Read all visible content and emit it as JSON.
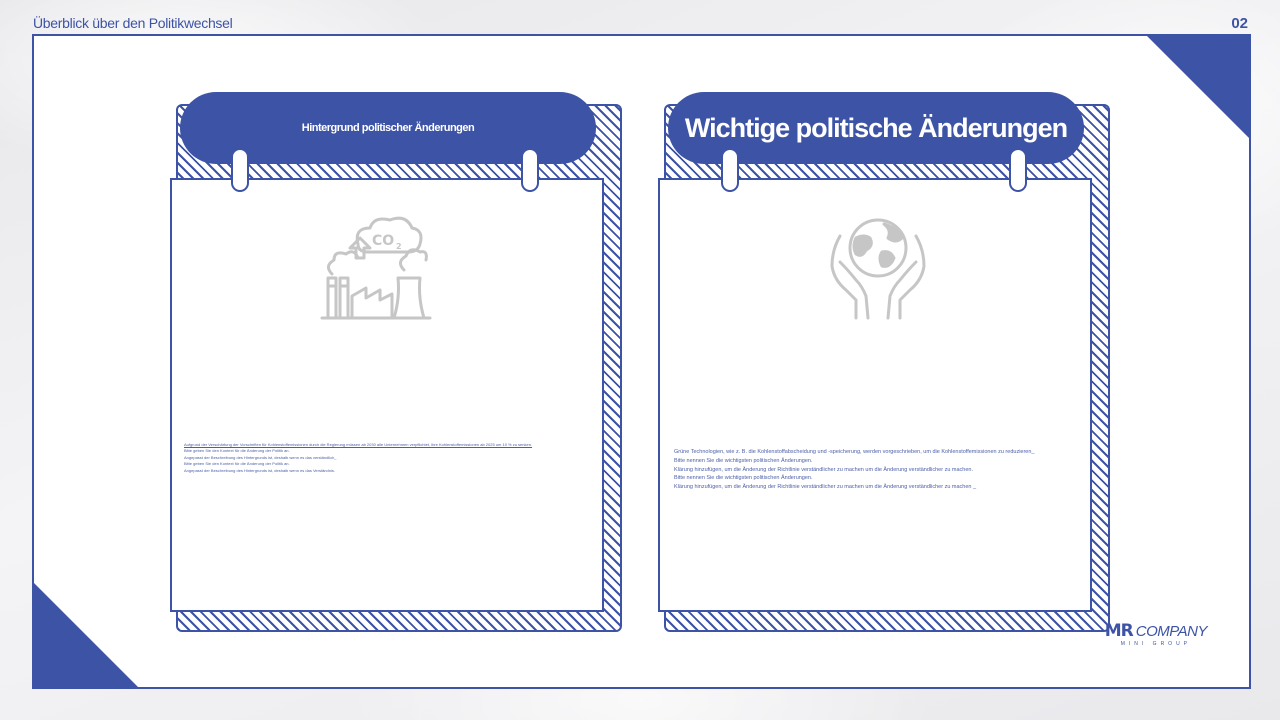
{
  "header": {
    "title": "Überblick über den Politikwechsel",
    "page_number": "02"
  },
  "colors": {
    "accent": "#3d53a5",
    "icon_gray": "#c6c6c6",
    "background": "#efeff1"
  },
  "cards": [
    {
      "heading": "Hintergrund politischer Änderungen",
      "icon": "co2-factory-icon",
      "lines": [
        "Aufgrund der Verschärfung der Vorschriften für Kohlenstoffemissionen durch die Regierung müssen ab 2030 alle Unternehmen verpflichtet, ihre Kohlenstoffemissionen ab 2025 um 10 % zu senken.",
        "Bitte geben Sie den Kontext für die Änderung der Politik an.",
        "Angepasst der Beschreibung des Hintergrunds ist, deshalb wenn es das verständlich_",
        "Bitte geben Sie den Kontext für die Änderung der Politik an.",
        "Angepasst der Beschreibung des Hintergrunds ist, deshalb wenn es das Verständnis."
      ]
    },
    {
      "heading": "Wichtige politische Änderungen",
      "icon": "globe-in-hands-icon",
      "lines": [
        "Grüne Technologien, wie z. B. die Kohlenstoffabscheidung und -speicherung, werden vorgeschrieben, um die Kohlenstoffemissionen zu reduzieren_",
        "Bitte nennen Sie die wichtigsten politischen Änderungen.",
        "Klärung hinzufügen, um die Änderung der Richtlinie verständlicher zu machen um die Änderung verständlicher zu machen.",
        "Bitte nennen Sie die wichtigsten politischen Änderungen.",
        "Klärung hinzufügen, um die Änderung der Richtlinie verständlicher zu machen um die Änderung verständlicher zu machen _"
      ]
    }
  ],
  "logo": {
    "mark": "MR",
    "name": "COMPANY",
    "tagline": "MINI GROUP"
  }
}
